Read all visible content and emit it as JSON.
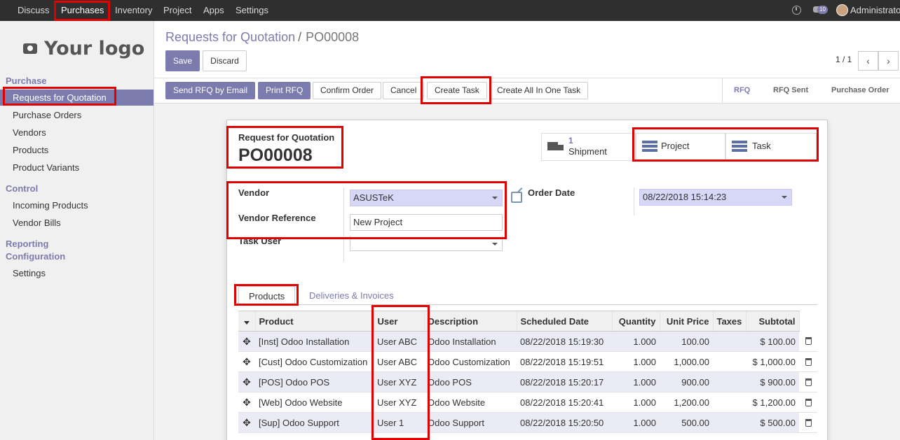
{
  "navbar": {
    "apps": [
      "Discuss",
      "Purchases",
      "Inventory",
      "Project",
      "Apps",
      "Settings"
    ],
    "active": "Purchases",
    "chat_count": "10",
    "user": "Administrator"
  },
  "sidebar": {
    "logo_text": "Your logo",
    "sections": [
      {
        "title": "Purchase",
        "items": [
          "Requests for Quotation",
          "Purchase Orders",
          "Vendors",
          "Products",
          "Product Variants"
        ]
      },
      {
        "title": "Control",
        "items": [
          "Incoming Products",
          "Vendor Bills"
        ]
      },
      {
        "title": "Reporting",
        "items": []
      },
      {
        "title": "Configuration",
        "items": [
          "Settings"
        ]
      }
    ],
    "active_item": "Requests for Quotation"
  },
  "breadcrumb": {
    "parent": "Requests for Quotation",
    "separator": "/",
    "current": "PO00008"
  },
  "controls": {
    "save": "Save",
    "discard": "Discard",
    "pager": "1 / 1"
  },
  "actions": [
    "Send RFQ by Email",
    "Print RFQ",
    "Confirm Order",
    "Cancel",
    "Create Task",
    "Create All In One Task"
  ],
  "stages": [
    "RFQ",
    "RFQ Sent",
    "Purchase Order"
  ],
  "active_stage": "RFQ",
  "smart_buttons": {
    "shipment_count": "1",
    "shipment_label": "Shipment",
    "project_label": "Project",
    "task_label": "Task"
  },
  "form": {
    "title_label": "Request for Quotation",
    "title": "PO00008",
    "vendor_label": "Vendor",
    "vendor_value": "ASUSTeK",
    "vendor_ref_label": "Vendor Reference",
    "vendor_ref_value": "New Project",
    "task_user_label": "Task User",
    "task_user_value": "",
    "order_date_label": "Order Date",
    "order_date_value": "08/22/2018 15:14:23"
  },
  "tabs": [
    "Products",
    "Deliveries & Invoices"
  ],
  "table": {
    "headers": [
      "Product",
      "User",
      "Description",
      "Scheduled Date",
      "Quantity",
      "Unit Price",
      "Taxes",
      "Subtotal"
    ],
    "rows": [
      {
        "product": "[Inst] Odoo Installation",
        "user": "User ABC",
        "description": "Odoo Installation",
        "date": "08/22/2018 15:19:30",
        "qty": "1.000",
        "price": "100.00",
        "taxes": "",
        "subtotal": "$ 100.00"
      },
      {
        "product": "[Cust] Odoo Customization",
        "user": "User ABC",
        "description": "Odoo Customization",
        "date": "08/22/2018 15:19:51",
        "qty": "1.000",
        "price": "1,000.00",
        "taxes": "",
        "subtotal": "$ 1,000.00"
      },
      {
        "product": "[POS] Odoo POS",
        "user": "User XYZ",
        "description": "Odoo POS",
        "date": "08/22/2018 15:20:17",
        "qty": "1.000",
        "price": "900.00",
        "taxes": "",
        "subtotal": "$ 900.00"
      },
      {
        "product": "[Web] Odoo Website",
        "user": "User XYZ",
        "description": "Odoo Website",
        "date": "08/22/2018 15:20:41",
        "qty": "1.000",
        "price": "1,200.00",
        "taxes": "",
        "subtotal": "$ 1,200.00"
      },
      {
        "product": "[Sup] Odoo Support",
        "user": "User 1",
        "description": "Odoo Support",
        "date": "08/22/2018 15:20:50",
        "qty": "1.000",
        "price": "500.00",
        "taxes": "",
        "subtotal": "$ 500.00"
      }
    ]
  },
  "colors": {
    "accent": "#7c7bad",
    "annotation": "#e00000",
    "navbar": "#2f2f2f"
  }
}
